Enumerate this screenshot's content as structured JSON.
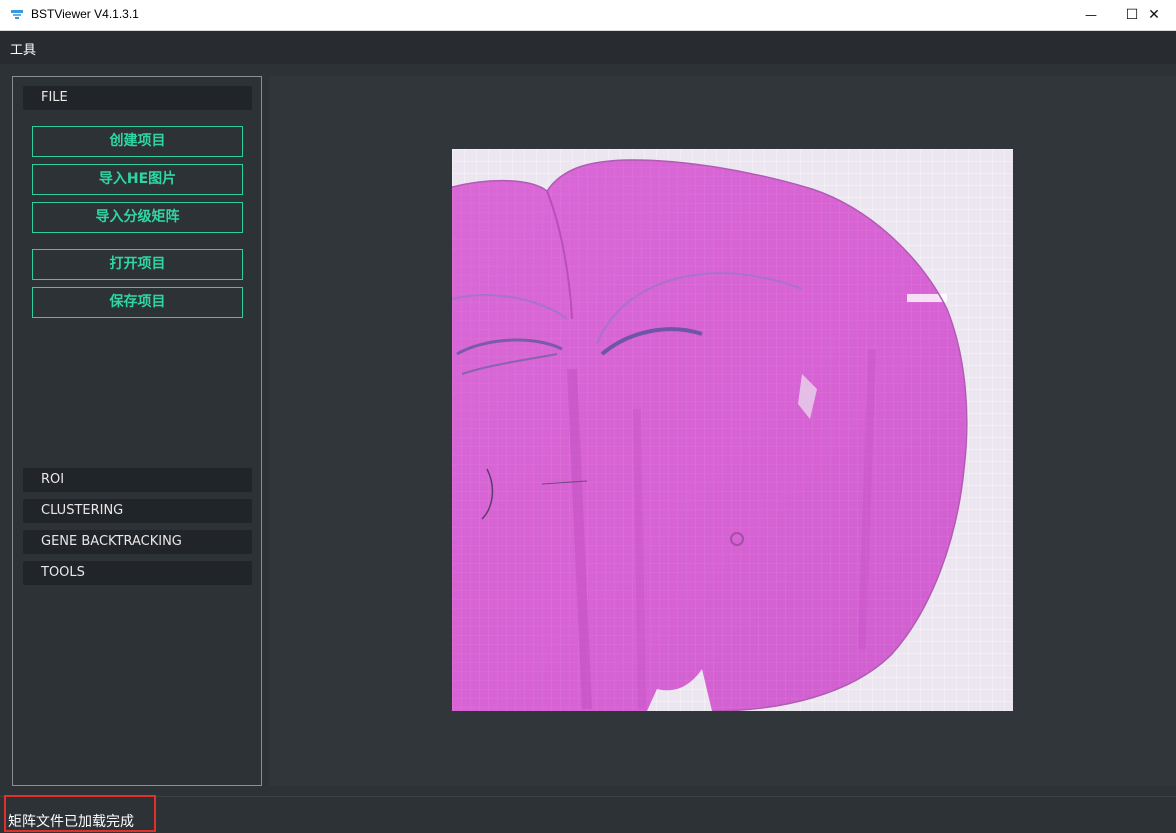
{
  "window": {
    "title": "BSTViewer V4.1.3.1",
    "minimize_glyph": "—",
    "maximize_glyph": "☐",
    "close_glyph": "✕"
  },
  "menu": {
    "tools": "工具"
  },
  "panel": {
    "file_header": "FILE",
    "buttons": {
      "create_project": "创建项目",
      "import_he": "导入HE图片",
      "import_matrix": "导入分级矩阵",
      "open_project": "打开项目",
      "save_project": "保存项目"
    },
    "sections": {
      "roi": "ROI",
      "clustering": "CLUSTERING",
      "gene_backtracking": "GENE BACKTRACKING",
      "tools": "TOOLS"
    }
  },
  "status": {
    "message": "矩阵文件已加载完成"
  },
  "colors": {
    "accent": "#2fd6a2",
    "background": "#2d3237",
    "status_highlight": "#e0302a",
    "tissue": "#d865d6"
  }
}
